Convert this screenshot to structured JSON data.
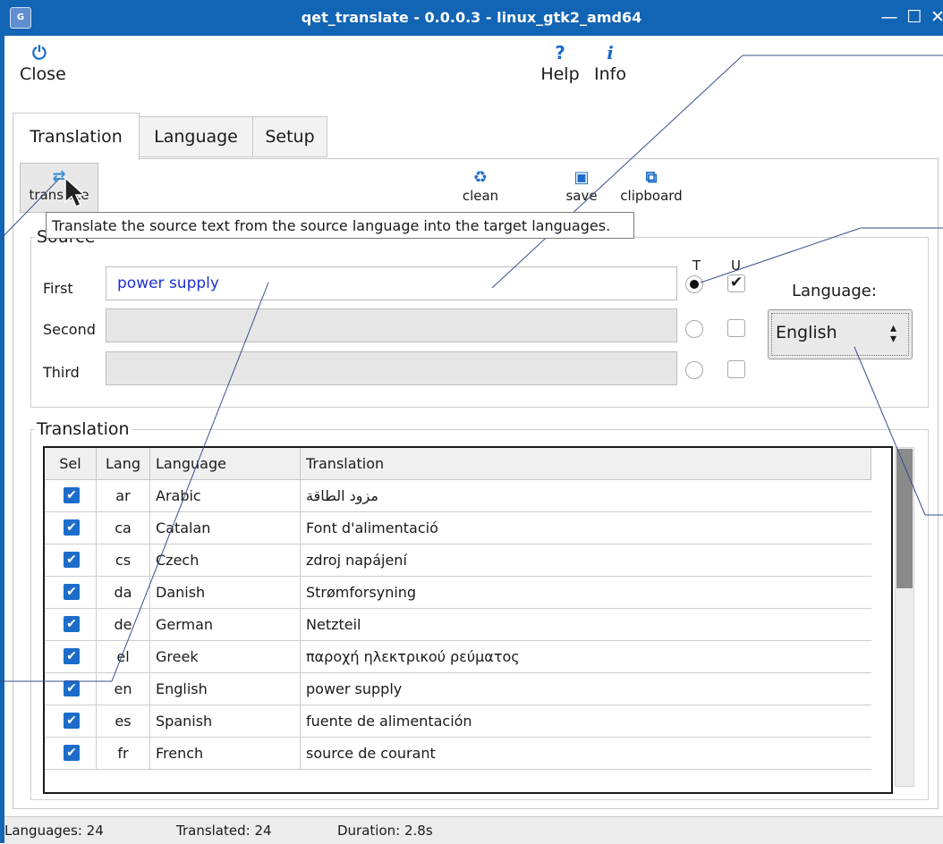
{
  "window": {
    "title": "qet_translate - 0.0.0.3 - linux_gtk2_amd64",
    "app_icon": "G"
  },
  "top_toolbar": {
    "close_label": "Close",
    "help_label": "Help",
    "info_label": "Info"
  },
  "tabs": [
    {
      "label": "Translation",
      "active": true
    },
    {
      "label": "Language"
    },
    {
      "label": "Setup"
    }
  ],
  "action_toolbar": {
    "translate_label": "translate",
    "clean_label": "clean",
    "save_label": "save",
    "clipboard_label": "clipboard",
    "translate_tooltip": "Translate the source text from the source language into the target languages."
  },
  "source": {
    "legend": "Source",
    "col_t": "T",
    "col_u": "U",
    "rows": [
      {
        "label": "First",
        "value": "power supply",
        "t": true,
        "u": true
      },
      {
        "label": "Second",
        "value": "",
        "t": false,
        "u": false
      },
      {
        "label": "Third",
        "value": "",
        "t": false,
        "u": false
      }
    ],
    "language_label": "Language:",
    "language_value": "English"
  },
  "translation": {
    "legend": "Translation",
    "headers": [
      "Sel",
      "Lang",
      "Language",
      "Translation"
    ],
    "rows": [
      {
        "sel": true,
        "code": "ar",
        "language": "Arabic",
        "text": "مزود الطاقة"
      },
      {
        "sel": true,
        "code": "ca",
        "language": "Catalan",
        "text": "Font d'alimentació"
      },
      {
        "sel": true,
        "code": "cs",
        "language": "Czech",
        "text": "zdroj napájení"
      },
      {
        "sel": true,
        "code": "da",
        "language": "Danish",
        "text": "Strømforsyning"
      },
      {
        "sel": true,
        "code": "de",
        "language": "German",
        "text": "Netzteil"
      },
      {
        "sel": true,
        "code": "el",
        "language": "Greek",
        "text": "παροχή ηλεκτρικού ρεύματος"
      },
      {
        "sel": true,
        "code": "en",
        "language": "English",
        "text": "power supply"
      },
      {
        "sel": true,
        "code": "es",
        "language": "Spanish",
        "text": "fuente de alimentación"
      },
      {
        "sel": true,
        "code": "fr",
        "language": "French",
        "text": "source de courant"
      }
    ]
  },
  "status": {
    "languages": "Languages:  24",
    "translated": "Translated:  24",
    "duration": "Duration:  2.8s"
  },
  "colors": {
    "titlebar": "#1264b4",
    "accent": "#1c6cc9",
    "text_blue": "#1c2fd0"
  },
  "icons": {
    "close": "power-icon",
    "help": "question-icon",
    "info": "info-icon",
    "translate": "refresh-arrows-icon",
    "clean": "recycle-icon",
    "save": "floppy-icon",
    "clipboard": "clipboard-icon"
  }
}
